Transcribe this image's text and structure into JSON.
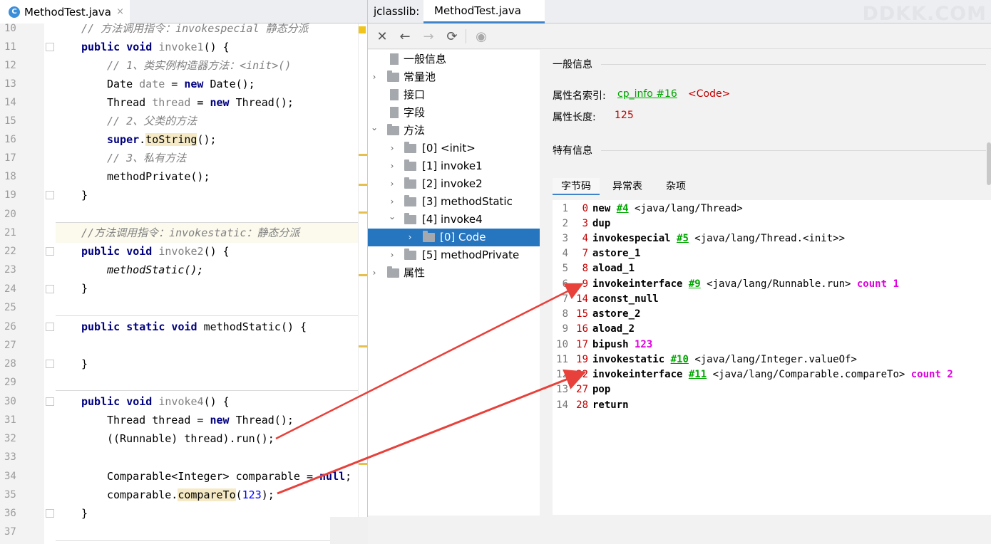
{
  "editor": {
    "tab_title": "MethodTest.java",
    "tab_icon": "C",
    "tab_close": "×",
    "lines": [
      {
        "n": "10"
      },
      {
        "n": "11"
      },
      {
        "n": "12"
      },
      {
        "n": "13"
      },
      {
        "n": "14"
      },
      {
        "n": "15"
      },
      {
        "n": "16"
      },
      {
        "n": "17"
      },
      {
        "n": "18"
      },
      {
        "n": "19"
      },
      {
        "n": "20"
      },
      {
        "n": "21"
      },
      {
        "n": "22"
      },
      {
        "n": "23"
      },
      {
        "n": "24"
      },
      {
        "n": "25"
      },
      {
        "n": "26"
      },
      {
        "n": "27"
      },
      {
        "n": "28"
      },
      {
        "n": "29"
      },
      {
        "n": "30"
      },
      {
        "n": "31"
      },
      {
        "n": "32"
      },
      {
        "n": "33"
      },
      {
        "n": "34"
      },
      {
        "n": "35"
      },
      {
        "n": "36"
      },
      {
        "n": "37"
      }
    ],
    "code": {
      "l10": "// 方法调用指令：invokespecial 静态分派",
      "l11_kw": "public void",
      "l11_name": "invoke1",
      "l11_rest": "() {",
      "l12": "// 1、类实例构造器方法：<init>()",
      "l13_a": "Date ",
      "l13_b": "date",
      "l13_c": " = ",
      "l13_kw": "new",
      "l13_d": " Date();",
      "l14_a": "Thread ",
      "l14_b": "thread",
      "l14_c": " = ",
      "l14_kw": "new",
      "l14_d": " Thread();",
      "l15": "// 2、父类的方法",
      "l16_kw": "super",
      "l16_dot": ".",
      "l16_m": "toString",
      "l16_rest": "();",
      "l17": "// 3、私有方法",
      "l18": "methodPrivate();",
      "l19": "}",
      "l21": "//方法调用指令：invokestatic：静态分派",
      "l22_kw": "public void",
      "l22_name": "invoke2",
      "l22_rest": "() {",
      "l23": "methodStatic();",
      "l24": "}",
      "l26_kw": "public static void",
      "l26_name": " methodStatic() {",
      "l28": "}",
      "l30_kw": "public void",
      "l30_name": "invoke4",
      "l30_rest": "() {",
      "l31_a": "Thread thread = ",
      "l31_kw": "new",
      "l31_b": " Thread();",
      "l32": "((Runnable) thread).run();",
      "l34_a": "Comparable<Integer> comparable = ",
      "l34_kw": "null",
      "l34_b": ";",
      "l35_a": "comparable.",
      "l35_m": "compareTo",
      "l35_b": "(",
      "l35_num": "123",
      "l35_c": ");",
      "l36": "}"
    }
  },
  "jclasslib": {
    "label": "jclasslib:",
    "tab_title": "MethodTest.java",
    "watermark": "DDKK.COM",
    "toolbar": {
      "close": "✕",
      "back": "←",
      "forward": "→",
      "refresh": "⟳",
      "web": "◉"
    },
    "tree": [
      {
        "label": "一般信息",
        "arrow": ""
      },
      {
        "label": "常量池",
        "arrow": "›"
      },
      {
        "label": "接口",
        "arrow": ""
      },
      {
        "label": "字段",
        "arrow": ""
      },
      {
        "label": "方法",
        "arrow": "⌄"
      },
      {
        "label": "[0] <init>",
        "arrow": "›"
      },
      {
        "label": "[1] invoke1",
        "arrow": "›"
      },
      {
        "label": "[2] invoke2",
        "arrow": "›"
      },
      {
        "label": "[3] methodStatic",
        "arrow": "›"
      },
      {
        "label": "[4] invoke4",
        "arrow": "⌄"
      },
      {
        "label": "[0] Code",
        "arrow": "›"
      },
      {
        "label": "[5] methodPrivate",
        "arrow": "›"
      },
      {
        "label": "属性",
        "arrow": "›"
      }
    ],
    "detail": {
      "general_title": "一般信息",
      "name_index_label": "属性名索引:",
      "name_index_link": "cp_info #16",
      "name_index_value": "<Code>",
      "length_label": "属性长度:",
      "length_value": "125",
      "specific_title": "特有信息",
      "subtabs": [
        "字节码",
        "异常表",
        "杂项"
      ]
    },
    "bytecode": [
      {
        "i": "1",
        "off": "0",
        "op": "new",
        "ref": "#4",
        "arg": " <java/lang/Thread>",
        "extra": ""
      },
      {
        "i": "2",
        "off": "3",
        "op": "dup",
        "ref": "",
        "arg": "",
        "extra": ""
      },
      {
        "i": "3",
        "off": "4",
        "op": "invokespecial",
        "ref": "#5",
        "arg": " <java/lang/Thread.<init>>",
        "extra": ""
      },
      {
        "i": "4",
        "off": "7",
        "op": "astore_1",
        "ref": "",
        "arg": "",
        "extra": ""
      },
      {
        "i": "5",
        "off": "8",
        "op": "aload_1",
        "ref": "",
        "arg": "",
        "extra": ""
      },
      {
        "i": "6",
        "off": "9",
        "op": "invokeinterface",
        "ref": "#9",
        "arg": " <java/lang/Runnable.run>",
        "extra": " count 1"
      },
      {
        "i": "7",
        "off": "14",
        "op": "aconst_null",
        "ref": "",
        "arg": "",
        "extra": ""
      },
      {
        "i": "8",
        "off": "15",
        "op": "astore_2",
        "ref": "",
        "arg": "",
        "extra": ""
      },
      {
        "i": "9",
        "off": "16",
        "op": "aload_2",
        "ref": "",
        "arg": "",
        "extra": ""
      },
      {
        "i": "10",
        "off": "17",
        "op": "bipush",
        "ref": "",
        "arg": "",
        "extra": " 123"
      },
      {
        "i": "11",
        "off": "19",
        "op": "invokestatic",
        "ref": "#10",
        "arg": " <java/lang/Integer.valueOf>",
        "extra": ""
      },
      {
        "i": "12",
        "off": "22",
        "op": "invokeinterface",
        "ref": "#11",
        "arg": " <java/lang/Comparable.compareTo>",
        "extra": " count 2"
      },
      {
        "i": "13",
        "off": "27",
        "op": "pop",
        "ref": "",
        "arg": "",
        "extra": ""
      },
      {
        "i": "14",
        "off": "28",
        "op": "return",
        "ref": "",
        "arg": "",
        "extra": ""
      }
    ]
  },
  "colors": {
    "selection": "#2675bf",
    "tab_underline": "#4083c9",
    "annotation_arrow": "#e8403a",
    "link_green": "#00a500",
    "offset_red": "#c00000",
    "magenta": "#e000e0"
  }
}
